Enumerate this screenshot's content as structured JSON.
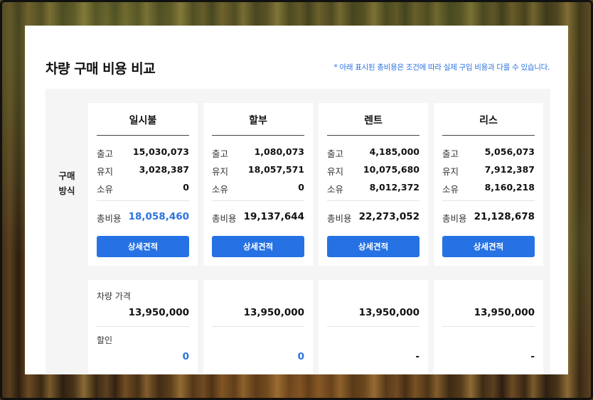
{
  "title": "차량 구매 비용 비교",
  "notice": "* 아래 표시된 총비용은 조건에 따라 실제 구입 비용과 다를 수 있습니다.",
  "row_label_line1": "구매",
  "row_label_line2": "방식",
  "labels": {
    "release": "출고",
    "maintain": "유지",
    "own": "소유",
    "total": "총비용",
    "car_price": "차량 가격",
    "discount": "할인"
  },
  "button_label": "상세견적",
  "plans": [
    {
      "name": "일시불",
      "release": "15,030,073",
      "maintain": "3,028,387",
      "own": "0",
      "total": "18,058,460",
      "car_price": "13,950,000",
      "discount": "0"
    },
    {
      "name": "할부",
      "release": "1,080,073",
      "maintain": "18,057,571",
      "own": "0",
      "total": "19,137,644",
      "car_price": "13,950,000",
      "discount": "0"
    },
    {
      "name": "렌트",
      "release": "4,185,000",
      "maintain": "10,075,680",
      "own": "8,012,372",
      "total": "22,273,052",
      "car_price": "13,950,000",
      "discount": "-"
    },
    {
      "name": "리스",
      "release": "5,056,073",
      "maintain": "7,912,387",
      "own": "8,160,218",
      "total": "21,128,678",
      "car_price": "13,950,000",
      "discount": "-"
    }
  ],
  "colors": {
    "accent": "#2672e4",
    "highlight_text": "#2b73e0"
  }
}
